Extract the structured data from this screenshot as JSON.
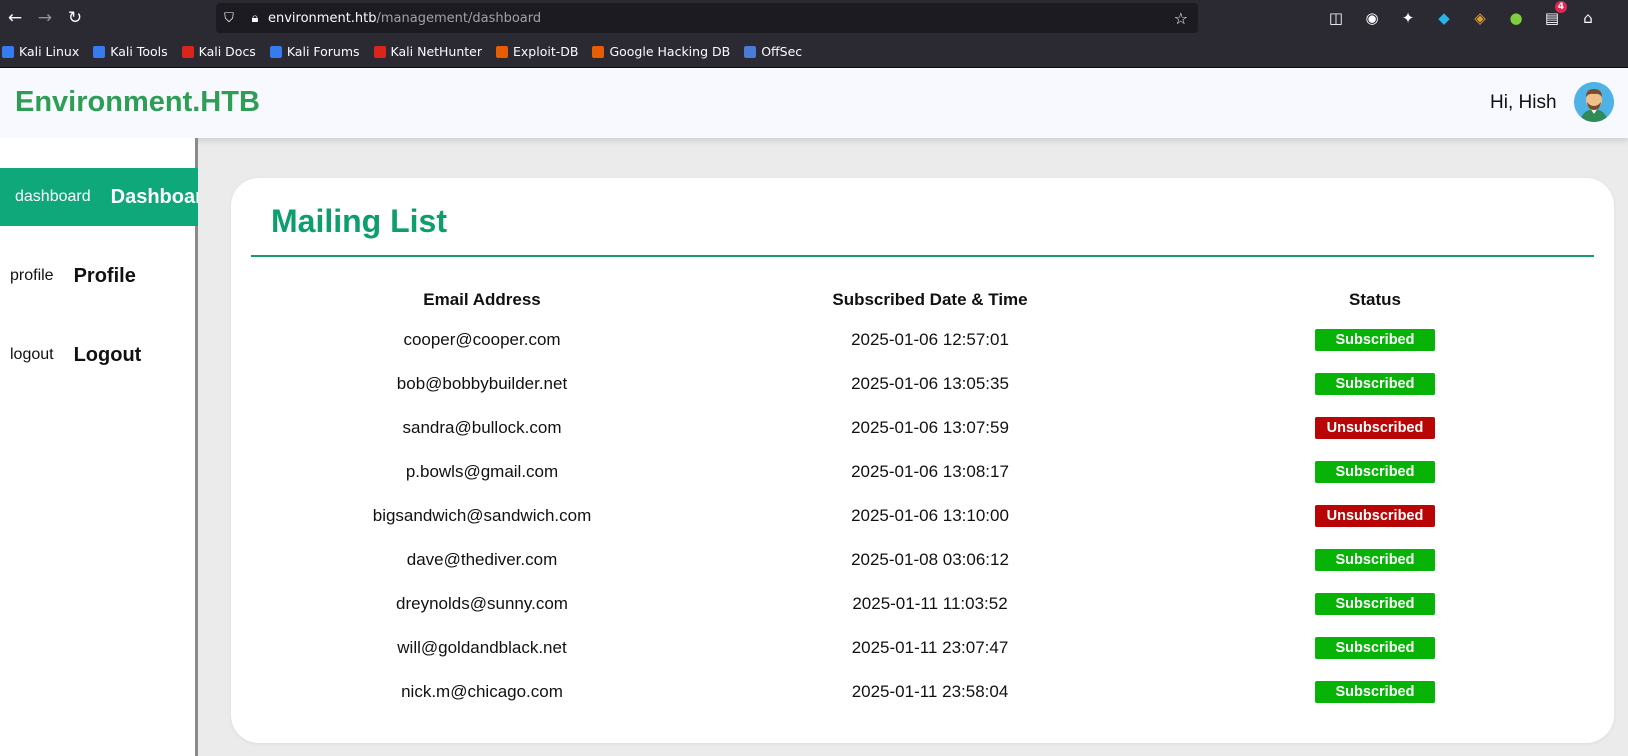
{
  "browser": {
    "url_host": "environment.htb",
    "url_path": "/management/dashboard",
    "notification_count": "4",
    "bookmarks": [
      {
        "label": "Kali Linux",
        "color": "#367bf0"
      },
      {
        "label": "Kali Tools",
        "color": "#367bf0"
      },
      {
        "label": "Kali Docs",
        "color": "#d9251c"
      },
      {
        "label": "Kali Forums",
        "color": "#367bf0"
      },
      {
        "label": "Kali NetHunter",
        "color": "#d9251c"
      },
      {
        "label": "Exploit-DB",
        "color": "#e85d04"
      },
      {
        "label": "Google Hacking DB",
        "color": "#e85d04"
      },
      {
        "label": "OffSec",
        "color": "#4a7bd6"
      }
    ]
  },
  "header": {
    "brand": "Environment.HTB",
    "greeting": "Hi, Hish"
  },
  "sidebar": {
    "items": [
      {
        "key": "dashboard",
        "label": "Dashboard",
        "active": true
      },
      {
        "key": "profile",
        "label": "Profile",
        "active": false
      },
      {
        "key": "logout",
        "label": "Logout",
        "active": false
      }
    ]
  },
  "main": {
    "title": "Mailing List",
    "columns": [
      "Email Address",
      "Subscribed Date & Time",
      "Status"
    ],
    "rows": [
      {
        "email": "cooper@cooper.com",
        "date": "2025-01-06 12:57:01",
        "status": "Subscribed"
      },
      {
        "email": "bob@bobbybuilder.net",
        "date": "2025-01-06 13:05:35",
        "status": "Subscribed"
      },
      {
        "email": "sandra@bullock.com",
        "date": "2025-01-06 13:07:59",
        "status": "Unsubscribed"
      },
      {
        "email": "p.bowls@gmail.com",
        "date": "2025-01-06 13:08:17",
        "status": "Subscribed"
      },
      {
        "email": "bigsandwich@sandwich.com",
        "date": "2025-01-06 13:10:00",
        "status": "Unsubscribed"
      },
      {
        "email": "dave@thediver.com",
        "date": "2025-01-08 03:06:12",
        "status": "Subscribed"
      },
      {
        "email": "dreynolds@sunny.com",
        "date": "2025-01-11 11:03:52",
        "status": "Subscribed"
      },
      {
        "email": "will@goldandblack.net",
        "date": "2025-01-11 23:07:47",
        "status": "Subscribed"
      },
      {
        "email": "nick.m@chicago.com",
        "date": "2025-01-11 23:58:04",
        "status": "Subscribed"
      }
    ]
  },
  "colors": {
    "brand": "#2e9e55",
    "accent": "#0fa87a",
    "subscribed": "#07b307",
    "unsubscribed": "#b90505"
  }
}
